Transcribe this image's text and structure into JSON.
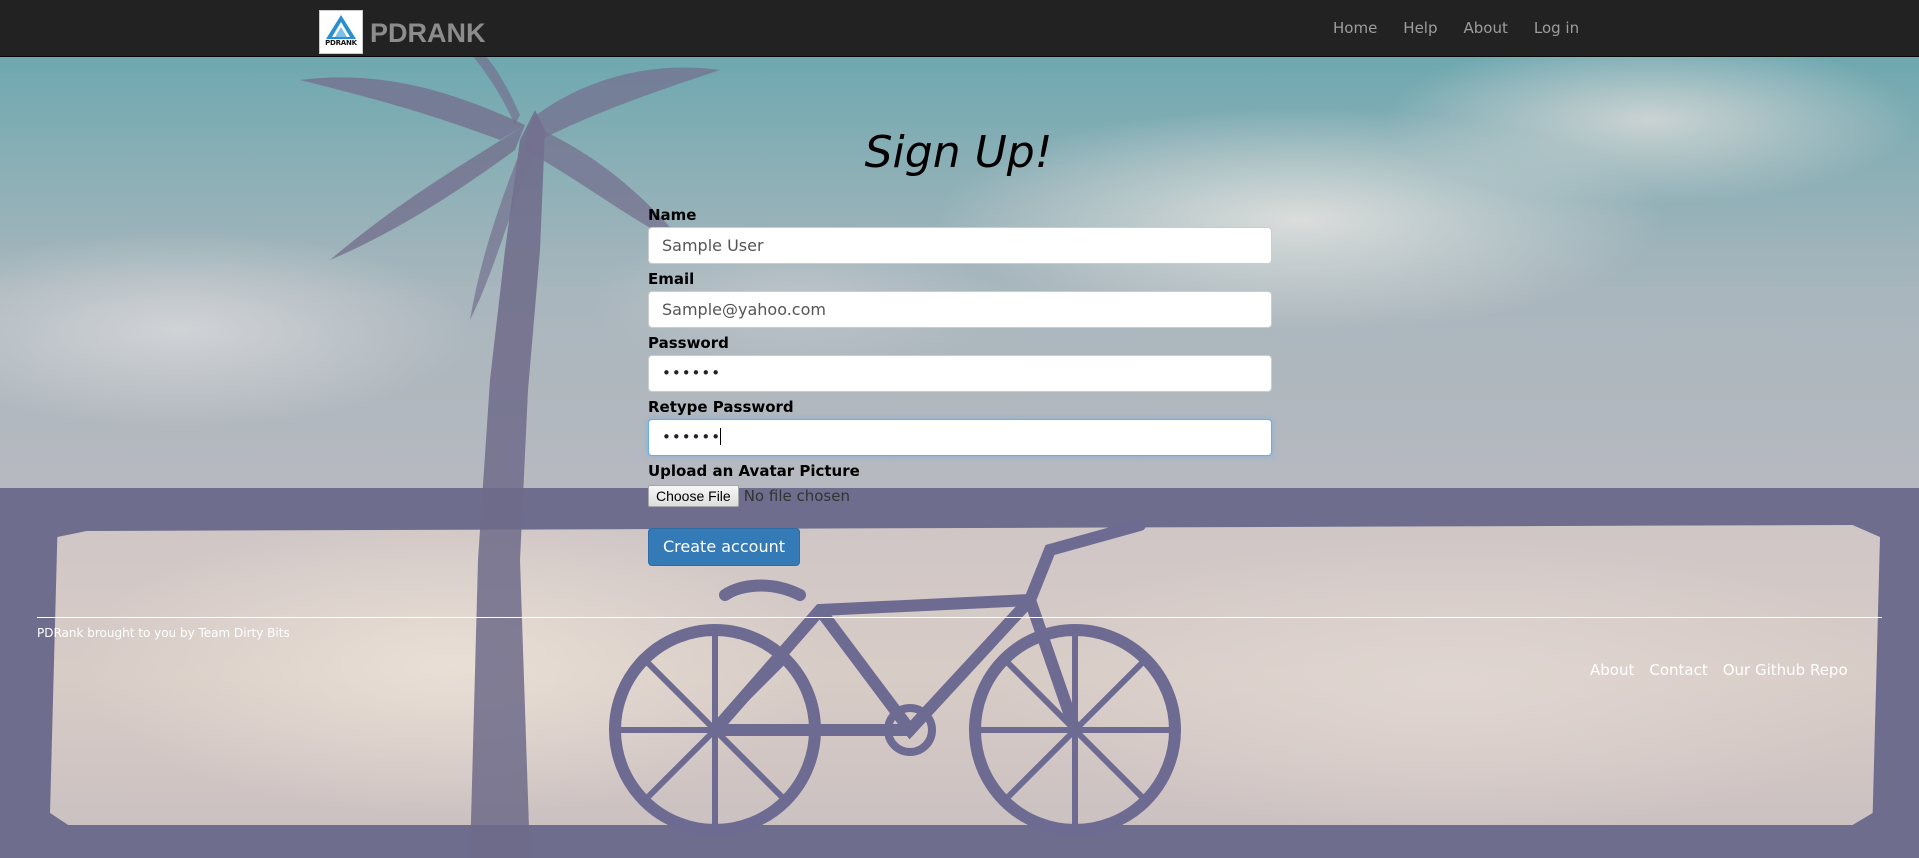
{
  "navbar": {
    "brand_logo_text": "PDRANK",
    "brand_name": "PDRANK",
    "links": [
      "Home",
      "Help",
      "About",
      "Log in"
    ]
  },
  "form": {
    "title": "Sign Up!",
    "fields": {
      "name": {
        "label": "Name",
        "value": "Sample User"
      },
      "email": {
        "label": "Email",
        "value": "Sample@yahoo.com"
      },
      "password": {
        "label": "Password",
        "value": "••••••"
      },
      "retype_password": {
        "label": "Retype Password",
        "value": "••••••"
      }
    },
    "avatar": {
      "label": "Upload an Avatar Picture",
      "button_label": "Choose File",
      "status": "No file chosen"
    },
    "submit_label": "Create account"
  },
  "footer": {
    "credit": "PDRank brought to you by Team Dirty Bits",
    "links": [
      "About",
      "Contact",
      "Our Github Repo"
    ]
  },
  "colors": {
    "navbar_bg": "#222222",
    "primary_button": "#337ab7",
    "focus_border": "#66afe9"
  }
}
